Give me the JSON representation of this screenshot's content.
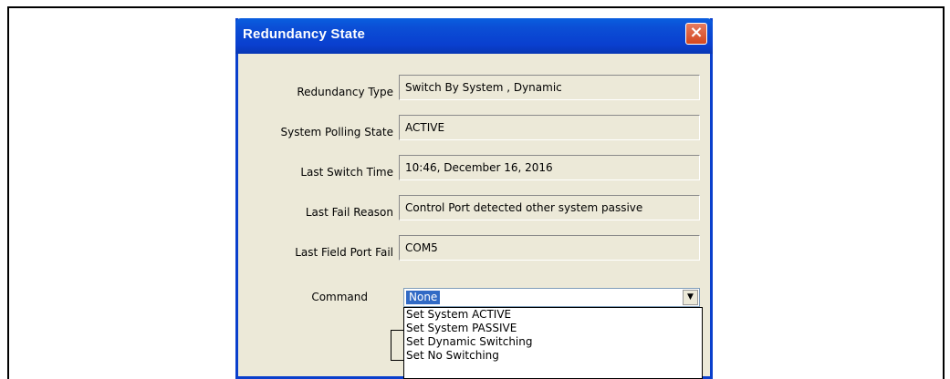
{
  "window": {
    "title": "Redundancy State",
    "close_glyph": "×"
  },
  "fields": [
    {
      "label": "Redundancy Type",
      "value": "Switch By System , Dynamic"
    },
    {
      "label": "System Polling State",
      "value": "ACTIVE"
    },
    {
      "label": "Last Switch Time",
      "value": "10:46, December 16, 2016"
    },
    {
      "label": "Last Fail Reason",
      "value": "Control Port detected other system passive"
    },
    {
      "label": "Last Field Port Fail",
      "value": "COM5"
    }
  ],
  "command": {
    "label": "Command",
    "selected": "None",
    "options": [
      "Set System ACTIVE",
      "Set System PASSIVE",
      "Set Dynamic Switching",
      "Set No Switching"
    ]
  },
  "colors": {
    "titlebar": "#0a3fcf",
    "dialog_bg": "#ece9d8",
    "selection": "#316ac5",
    "close": "#d4471f"
  }
}
